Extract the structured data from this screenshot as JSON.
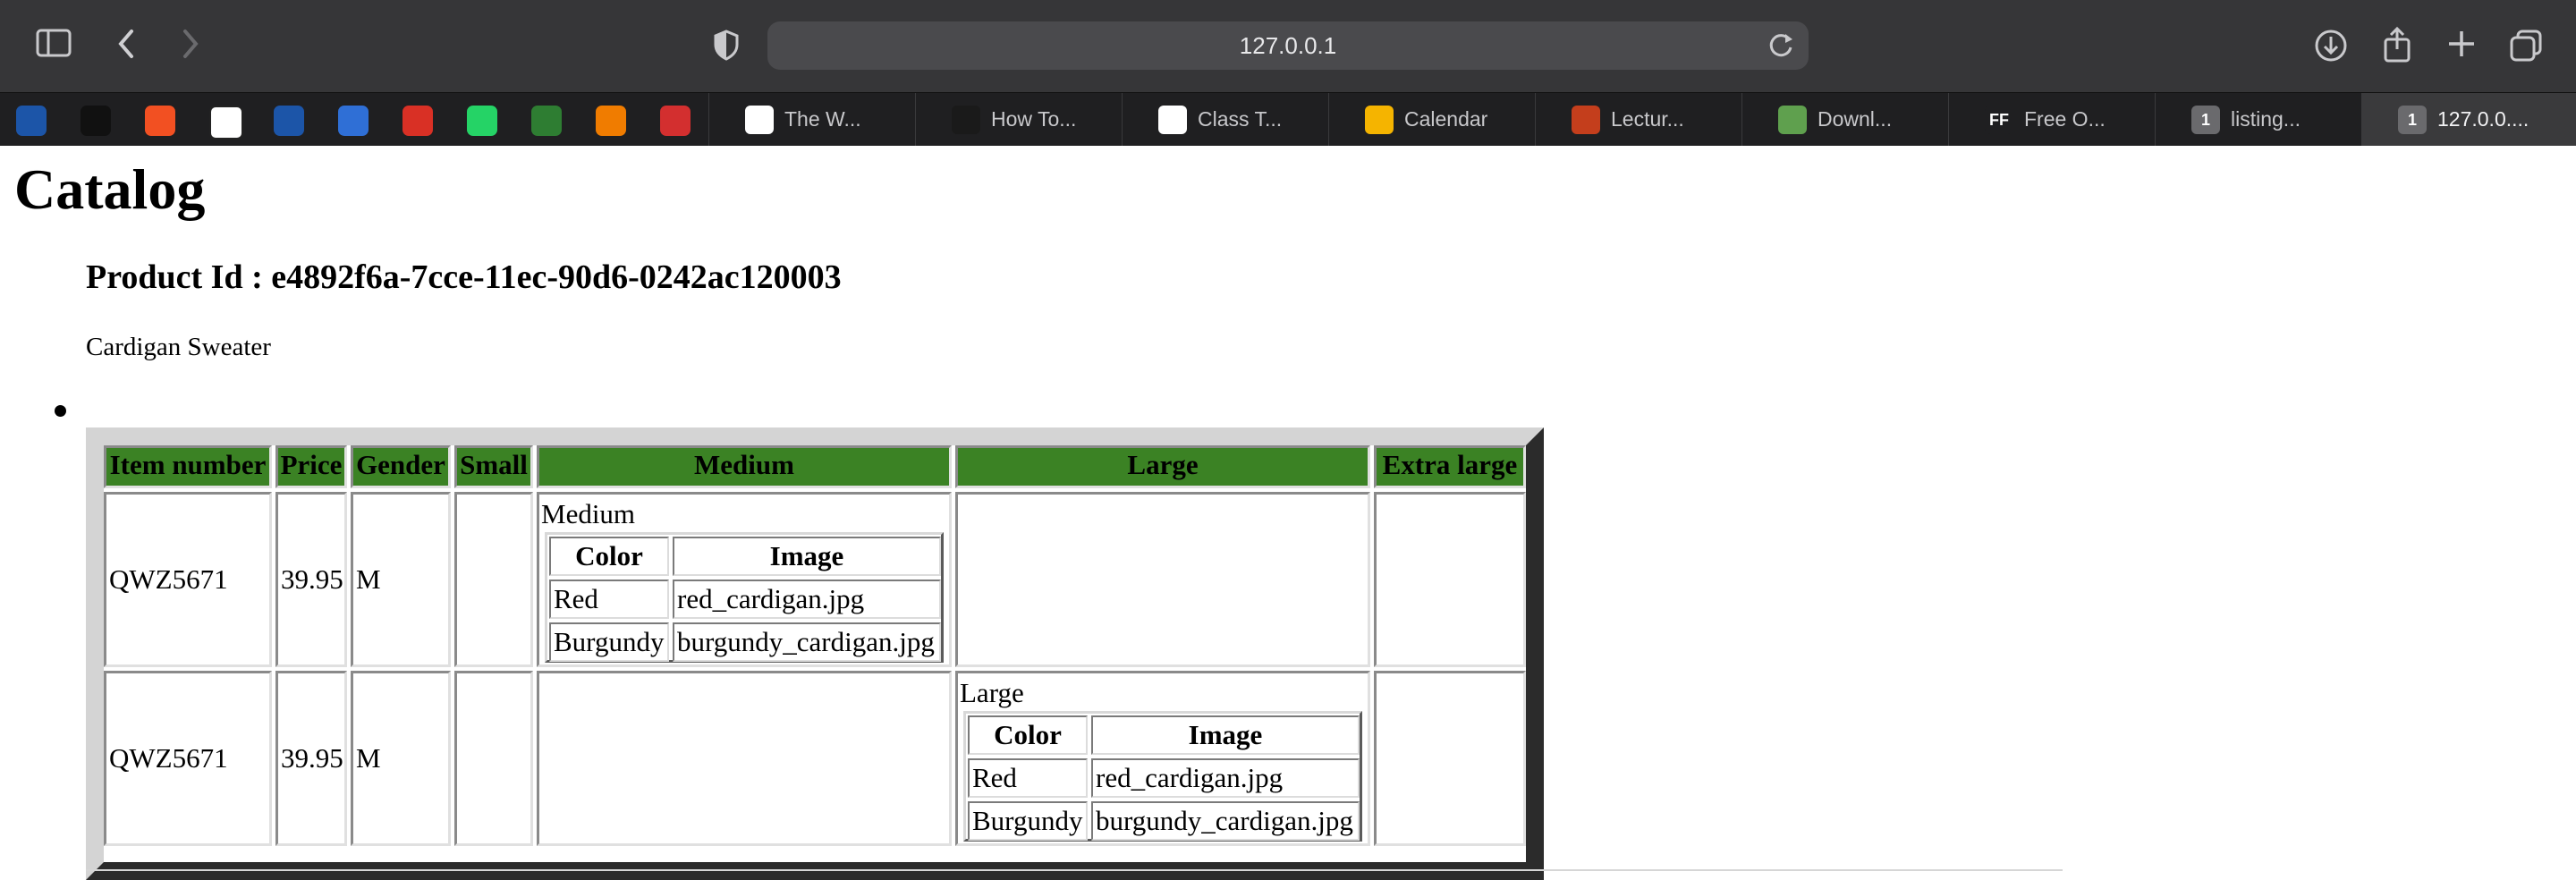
{
  "browser": {
    "url": "127.0.0.1",
    "favorites": [
      {
        "icon": "hammer-app-icon",
        "color": "#1c55a8"
      },
      {
        "icon": "app-icon",
        "color": "#111111"
      },
      {
        "icon": "microsoft-icon",
        "color": "#f25022"
      },
      {
        "icon": "github-icon",
        "color": "#ffffff"
      },
      {
        "icon": "hammer-app-icon",
        "color": "#1c55a8"
      },
      {
        "icon": "app-icon",
        "color": "#2f6fd6"
      },
      {
        "icon": "gmail-icon",
        "color": "#d93025"
      },
      {
        "icon": "whatsapp-icon",
        "color": "#25d366"
      },
      {
        "icon": "w3-icon",
        "color": "#2e7d32"
      },
      {
        "icon": "orbit-icon",
        "color": "#f07c00"
      },
      {
        "icon": "app-icon",
        "color": "#d32f2f"
      }
    ],
    "tabs": [
      {
        "icon": "document-icon",
        "label": "The W...",
        "active": false
      },
      {
        "icon": "dark-icon",
        "label": "How To...",
        "active": false
      },
      {
        "icon": "github-icon",
        "label": "Class T...",
        "active": false
      },
      {
        "icon": "calendar-icon",
        "label": "Calendar",
        "active": false
      },
      {
        "icon": "powerpoint-icon",
        "label": "Lectur...",
        "active": false
      },
      {
        "icon": "nodejs-icon",
        "label": "Downl...",
        "active": false
      },
      {
        "icon": "ff-icon",
        "icon_text": "FF",
        "label": "Free O...",
        "active": false
      },
      {
        "icon": "number-icon",
        "icon_text": "1",
        "label": "listing...",
        "active": false
      },
      {
        "icon": "number-icon",
        "icon_text": "1",
        "label": "127.0.0....",
        "active": true
      }
    ]
  },
  "page": {
    "title": "Catalog",
    "product_id": "Product Id : e4892f6a-7cce-11ec-90d6-0242ac120003",
    "product_name": "Cardigan Sweater",
    "table": {
      "headers": [
        "Item number",
        "Price",
        "Gender",
        "Small",
        "Medium",
        "Large",
        "Extra large"
      ],
      "rows": [
        {
          "item_number": "QWZ5671",
          "price": "39.95",
          "gender": "M",
          "size_caption": "Medium",
          "inner_headers": [
            "Color",
            "Image"
          ],
          "inner_rows": [
            [
              "Red",
              "red_cardigan.jpg"
            ],
            [
              "Burgundy",
              "burgundy_cardigan.jpg"
            ]
          ]
        },
        {
          "item_number": "QWZ5671",
          "price": "39.95",
          "gender": "M",
          "size_caption": "Large",
          "inner_headers": [
            "Color",
            "Image"
          ],
          "inner_rows": [
            [
              "Red",
              "red_cardigan.jpg"
            ],
            [
              "Burgundy",
              "burgundy_cardigan.jpg"
            ]
          ]
        }
      ]
    },
    "colors": {
      "header_bg": "#3b8224"
    }
  }
}
